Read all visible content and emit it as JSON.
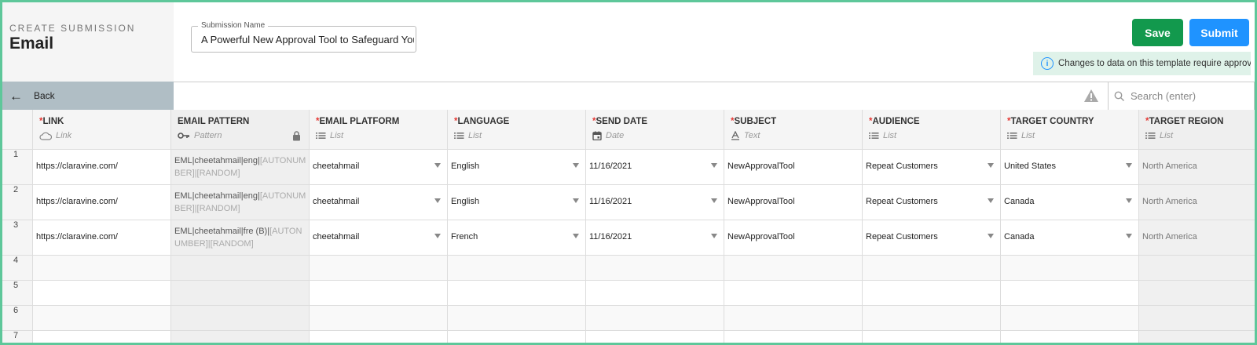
{
  "header": {
    "subtitle": "CREATE SUBMISSION",
    "title": "Email",
    "submission_name_label": "Submission Name",
    "submission_name_value": "A Powerful New Approval Tool to Safeguard Your",
    "save_label": "Save",
    "submit_label": "Submit",
    "notice": "Changes to data on this template require approval"
  },
  "toolbar": {
    "back_label": "Back",
    "search_placeholder": "Search (enter)"
  },
  "columns": [
    {
      "name": "LINK",
      "required": "*",
      "type": "Link",
      "icon": "cloud-icon"
    },
    {
      "name": "EMAIL PATTERN",
      "required": "",
      "type": "Pattern",
      "icon": "key-icon"
    },
    {
      "name": "EMAIL PLATFORM",
      "required": "*",
      "type": "List",
      "icon": "list-icon"
    },
    {
      "name": "LANGUAGE",
      "required": "*",
      "type": "List",
      "icon": "list-icon"
    },
    {
      "name": "SEND DATE",
      "required": "*",
      "type": "Date",
      "icon": "calendar-icon"
    },
    {
      "name": "SUBJECT",
      "required": "*",
      "type": "Text",
      "icon": "text-icon"
    },
    {
      "name": "AUDIENCE",
      "required": "*",
      "type": "List",
      "icon": "list-icon"
    },
    {
      "name": "TARGET COUNTRY",
      "required": "*",
      "type": "List",
      "icon": "list-icon"
    },
    {
      "name": "TARGET REGION",
      "required": "*",
      "type": "List",
      "icon": "list-icon"
    }
  ],
  "rows": [
    {
      "num": "1",
      "link": "https://claravine.com/",
      "pattern_a": "EML|cheetahmail|eng|",
      "pattern_b": "[AUTONUMBER]|[RANDOM]",
      "platform": "cheetahmail",
      "language": "English",
      "send_date": "11/16/2021",
      "subject": "NewApprovalTool",
      "audience": "Repeat Customers",
      "country": "United States",
      "region": "North America"
    },
    {
      "num": "2",
      "link": "https://claravine.com/",
      "pattern_a": "EML|cheetahmail|eng|",
      "pattern_b": "[AUTONUMBER]|[RANDOM]",
      "platform": "cheetahmail",
      "language": "English",
      "send_date": "11/16/2021",
      "subject": "NewApprovalTool",
      "audience": "Repeat Customers",
      "country": "Canada",
      "region": "North America"
    },
    {
      "num": "3",
      "link": "https://claravine.com/",
      "pattern_a": "EML|cheetahmail|fre (B)|",
      "pattern_b": "[AUTONUMBER]|[RANDOM]",
      "platform": "cheetahmail",
      "language": "French",
      "send_date": "11/16/2021",
      "subject": "NewApprovalTool",
      "audience": "Repeat Customers",
      "country": "Canada",
      "region": "North America"
    }
  ],
  "empty_rows": [
    "4",
    "5",
    "6",
    "7"
  ],
  "colors": {
    "accent": "#5ec79a",
    "save": "#12994d",
    "submit": "#1f93ff",
    "required": "#e53935"
  }
}
